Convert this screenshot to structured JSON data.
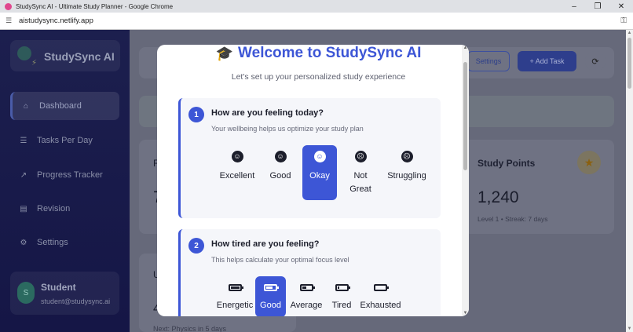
{
  "window": {
    "title": "StudySync AI - Ultimate Study Planner - Google Chrome",
    "minimize": "–",
    "restore": "❐",
    "close": "✕"
  },
  "address_bar": {
    "url": "aistudysync.netlify.app"
  },
  "sidebar": {
    "brand": "StudySync AI",
    "items": [
      {
        "label": "Dashboard",
        "icon": "home-icon",
        "glyph": "⌂",
        "active": true
      },
      {
        "label": "Tasks Per Day",
        "icon": "list-icon",
        "glyph": "☰",
        "active": false
      },
      {
        "label": "Progress Tracker",
        "icon": "chart-line-icon",
        "glyph": "↗",
        "active": false
      },
      {
        "label": "Revision",
        "icon": "book-icon",
        "glyph": "▤",
        "active": false
      },
      {
        "label": "Settings",
        "icon": "gears-icon",
        "glyph": "⚙",
        "active": false
      }
    ],
    "profile": {
      "initial": "S",
      "name": "Student",
      "email": "student@studysync.ai"
    }
  },
  "header": {
    "settings_label": "Settings",
    "add_task_label": "+ Add Task",
    "refresh_glyph": "⟳"
  },
  "stats": {
    "study_points_title": "Study Points",
    "study_points_value": "1,240",
    "study_points_sub": "Level 1 • Streak: 7 days",
    "left_frag_1": "F",
    "left_frag_2": "7",
    "left_frag_3": "U",
    "left_frag_4": "4",
    "next_text": "Next: Physics in 5 days"
  },
  "modal": {
    "title": "Welcome to StudySync AI",
    "subtitle": "Let's set up your personalized study experience",
    "questions": [
      {
        "number": "1",
        "text": "How are you feeling today?",
        "hint": "Your wellbeing helps us optimize your study plan",
        "options": [
          {
            "label": "Excellent",
            "icon": "laugh-icon",
            "glyph": "☺",
            "selected": false
          },
          {
            "label": "Good",
            "icon": "smile-icon",
            "glyph": "☺",
            "selected": false
          },
          {
            "label": "Okay",
            "icon": "neutral-face-icon",
            "glyph": "☺",
            "selected": true
          },
          {
            "label": "Not Great",
            "icon": "frown-icon",
            "glyph": "☹",
            "selected": false
          },
          {
            "label": "Struggling",
            "icon": "sad-tear-icon",
            "glyph": "☹",
            "selected": false
          }
        ]
      },
      {
        "number": "2",
        "text": "How tired are you feeling?",
        "hint": "This helps calculate your optimal focus level",
        "options": [
          {
            "label": "Energetic",
            "icon": "battery-full-icon",
            "charge": 1.0,
            "selected": false
          },
          {
            "label": "Good",
            "icon": "battery-three-quarters-icon",
            "charge": 0.75,
            "selected": true
          },
          {
            "label": "Average",
            "icon": "battery-half-icon",
            "charge": 0.5,
            "selected": false
          },
          {
            "label": "Tired",
            "icon": "battery-quarter-icon",
            "charge": 0.25,
            "selected": false
          },
          {
            "label": "Exhausted",
            "icon": "battery-empty-icon",
            "charge": 0.0,
            "selected": false
          }
        ]
      }
    ]
  },
  "colors": {
    "accent": "#3d56d6",
    "sidebar_bg": "#1c1f4e",
    "overlay": "#626578"
  }
}
